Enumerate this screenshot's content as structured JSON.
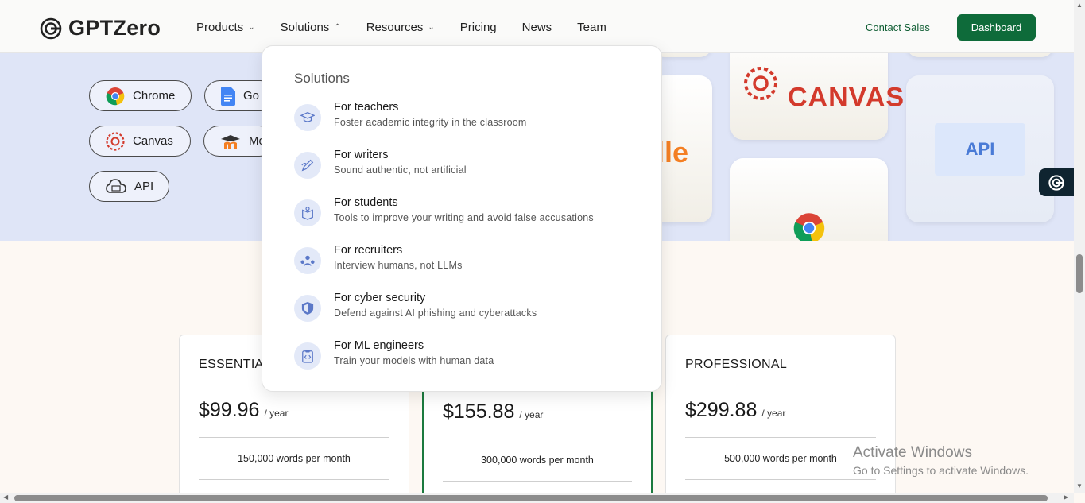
{
  "header": {
    "logo_text": "GPTZero",
    "nav": [
      {
        "label": "Products",
        "has_chevron": true,
        "chevron": "⌄"
      },
      {
        "label": "Solutions",
        "has_chevron": true,
        "chevron": "⌃"
      },
      {
        "label": "Resources",
        "has_chevron": true,
        "chevron": "⌄"
      },
      {
        "label": "Pricing",
        "has_chevron": false,
        "chevron": ""
      },
      {
        "label": "News",
        "has_chevron": false,
        "chevron": ""
      },
      {
        "label": "Team",
        "has_chevron": false,
        "chevron": ""
      }
    ],
    "contact_label": "Contact Sales",
    "dashboard_label": "Dashboard"
  },
  "integrations": {
    "pills": [
      {
        "label": "Chrome",
        "icon": "chrome-icon"
      },
      {
        "label": "Go",
        "icon": "google-docs-icon"
      },
      {
        "label": "Canvas",
        "icon": "canvas-icon"
      },
      {
        "label": "Mo",
        "icon": "moodle-icon"
      },
      {
        "label": "API",
        "icon": "api-cloud-icon"
      }
    ],
    "tiles": {
      "canvas_text": "CANVAS",
      "api_text": "API",
      "moodle_fragment": "lle"
    }
  },
  "solutions_menu": {
    "title": "Solutions",
    "items": [
      {
        "label": "For teachers",
        "desc": "Foster academic integrity in the classroom",
        "icon": "graduation-cap-icon"
      },
      {
        "label": "For writers",
        "desc": "Sound authentic, not artificial",
        "icon": "pen-icon"
      },
      {
        "label": "For students",
        "desc": "Tools to improve your writing and avoid false accusations",
        "icon": "book-icon"
      },
      {
        "label": "For recruiters",
        "desc": "Interview humans, not LLMs",
        "icon": "people-icon"
      },
      {
        "label": "For cyber security",
        "desc": "Defend against AI phishing and cyberattacks",
        "icon": "shield-icon"
      },
      {
        "label": "For ML engineers",
        "desc": "Train your models with human data",
        "icon": "code-clipboard-icon"
      }
    ]
  },
  "pricing": {
    "cards": [
      {
        "title": "ESSENTIA",
        "price": "$99.96",
        "per": "/ year",
        "words": "150,000 words per month"
      },
      {
        "title": "",
        "price": "$155.88",
        "per": "/ year",
        "words": "300,000 words per month",
        "highlight_color": "#1b7a3e"
      },
      {
        "title": "PROFESSIONAL",
        "price": "$299.88",
        "per": "/ year",
        "words": "500,000 words per month"
      }
    ]
  },
  "watermark": {
    "line1": "Activate Windows",
    "line2": "Go to Settings to activate Windows."
  }
}
